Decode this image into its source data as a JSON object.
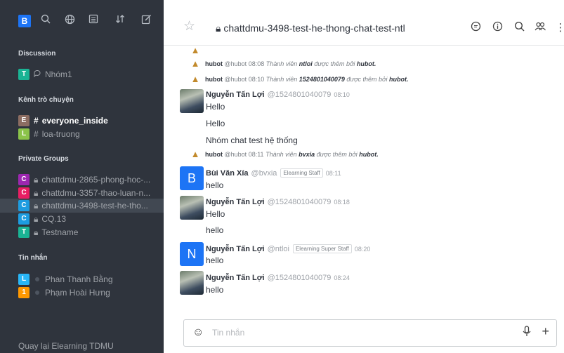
{
  "sidebar": {
    "user_avatar_letter": "B",
    "sections": {
      "discussion": "Discussion",
      "channels": "Kênh trò chuyện",
      "private": "Private Groups",
      "dm": "Tin nhắn"
    },
    "discussion_items": [
      {
        "letter": "T",
        "label": "Nhóm1",
        "color": "#1ab394"
      }
    ],
    "channel_items": [
      {
        "letter": "E",
        "label": "everyone_inside",
        "color": "#8c6d62"
      },
      {
        "letter": "L",
        "label": "loa-truong",
        "color": "#8bc34a"
      }
    ],
    "private_items": [
      {
        "letter": "C",
        "label": "chattdmu-2865-phong-hoc-...",
        "color": "#9c27b0"
      },
      {
        "letter": "C",
        "label": "chattdmu-3357-thao-luan-n...",
        "color": "#e91e63"
      },
      {
        "letter": "C",
        "label": "chattdmu-3498-test-he-tho...",
        "color": "#1d9ce0"
      },
      {
        "letter": "C",
        "label": "CQ.13",
        "color": "#1d9ce0"
      },
      {
        "letter": "T",
        "label": "Testname",
        "color": "#1ab394"
      }
    ],
    "dm_items": [
      {
        "letter": "L",
        "label": "Phan Thanh Bằng",
        "color": "#29b6f6"
      },
      {
        "letter": "1",
        "label": "Phạm Hoài Hưng",
        "color": "#ff9800"
      }
    ],
    "footer": "Quay lại Elearning TDMU"
  },
  "header": {
    "room_title": "chattdmu-3498-test-he-thong-chat-test-ntl"
  },
  "messages": {
    "sys1": {
      "user": "hubot",
      "handle": "@hubot",
      "time": "08:08",
      "pre": "Thành viên",
      "name": "ntloi",
      "post": "được thêm bởi",
      "by": "hubot."
    },
    "sys2": {
      "user": "hubot",
      "handle": "@hubot",
      "time": "08:10",
      "pre": "Thành viên",
      "name": "1524801040079",
      "post": "được thêm bởi",
      "by": "hubot."
    },
    "m1": {
      "user": "Nguyễn Tấn Lợi",
      "handle": "@1524801040079",
      "time": "08:10",
      "lines": [
        "Hello",
        "Hello",
        "Nhóm chat test hệ thống"
      ]
    },
    "sys3": {
      "user": "hubot",
      "handle": "@hubot",
      "time": "08:11",
      "pre": "Thành viên",
      "name": "bvxia",
      "post": "được thêm bởi",
      "by": "hubot."
    },
    "m2": {
      "user": "Bùi Văn Xía",
      "handle": "@bvxia",
      "role": "Elearning Staff",
      "time": "08:11",
      "avatar": "B",
      "text": "hello"
    },
    "m3": {
      "user": "Nguyễn Tấn Lợi",
      "handle": "@1524801040079",
      "time": "08:18",
      "lines": [
        "Hello",
        "hello"
      ]
    },
    "m4": {
      "user": "Nguyễn Tấn Lợi",
      "handle": "@ntloi",
      "role": "Elearning Super Staff",
      "time": "08:20",
      "avatar": "N",
      "text": "hello"
    },
    "m5": {
      "user": "Nguyễn Tấn Lợi",
      "handle": "@1524801040079",
      "time": "08:24",
      "text": "hello"
    }
  },
  "composer": {
    "placeholder": "Tin nhắn"
  }
}
